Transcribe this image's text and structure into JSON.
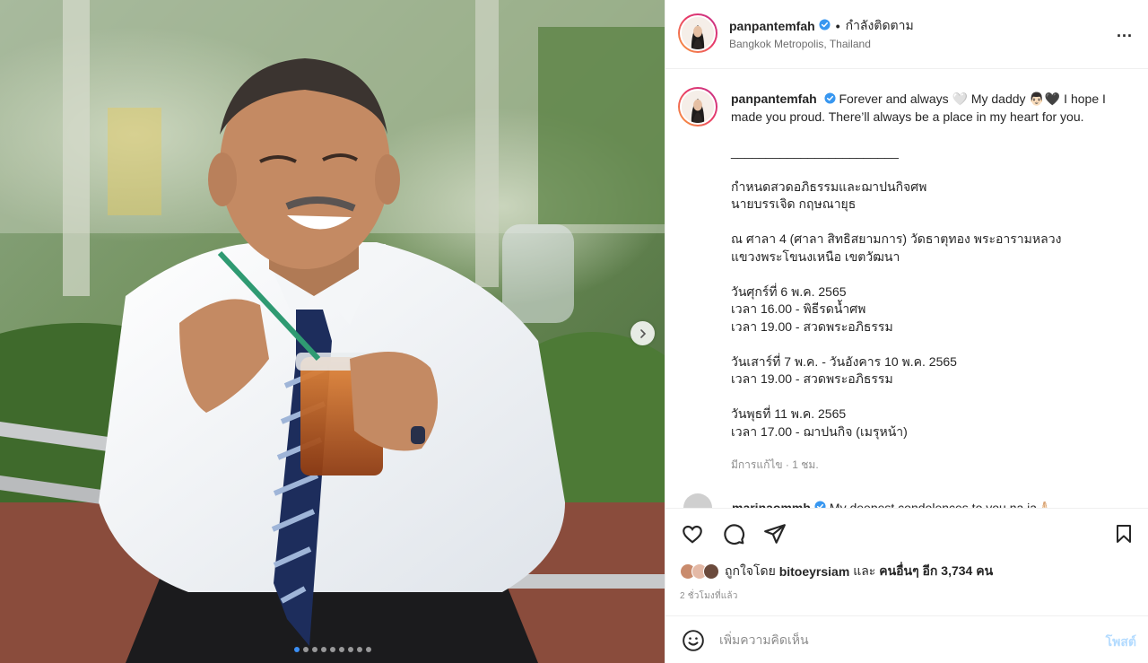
{
  "media": {
    "carousel": {
      "total_slides": 9,
      "active_slide": 1
    }
  },
  "header": {
    "username": "panpantemfah",
    "separator": "•",
    "follow_status": "กำลังติดตาม",
    "location": "Bangkok Metropolis, Thailand",
    "more_label": "..."
  },
  "caption": {
    "username": "panpantemfah",
    "lines": [
      "Forever and always 🤍 My daddy 👨🏻🖤 I hope I",
      "made you proud. There’ll always be a place in my heart for you.",
      "",
      "________________________",
      "",
      "กำหนดสวดอภิธรรมและฌาปนกิจศพ",
      "นายบรรเจิด กฤษณายุธ",
      "",
      "ณ ศาลา 4 (ศาลา สิทธิสยามการ) วัดธาตุทอง พระอารามหลวง",
      "แขวงพระโขนงเหนือ เขตวัฒนา",
      "",
      "วันศุกร์ที่ 6 พ.ค. 2565",
      "เวลา 16.00 - พิธีรดน้ำศพ",
      "เวลา 19.00 - สวดพระอภิธรรม",
      "",
      "วันเสาร์ที่ 7 พ.ค. - วันอังคาร 10 พ.ค. 2565",
      "เวลา 19.00 - สวดพระอภิธรรม",
      "",
      "วันพุธที่ 11 พ.ค. 2565",
      "เวลา 17.00 - ฌาปนกิจ (เมรุหน้า)"
    ],
    "edited": "มีการแก้ไข · 1 ชม."
  },
  "comment_peek": {
    "username": "marinaommh",
    "text": "My deepest condolences to you na ja🙏🏻"
  },
  "actions": {
    "likes_prefix": "ถูกใจโดย",
    "likes_user": "bitoeyrsiam",
    "likes_middle": "และ",
    "likes_others": "คนอื่นๆ อีก 3,734 คน",
    "time_ago": "2 ชั่วโมงที่แล้ว"
  },
  "comment_box": {
    "placeholder": "เพิ่มความคิดเห็น",
    "post_label": "โพสต์"
  },
  "icons": {
    "like": "heart-icon",
    "comment": "comment-icon",
    "share": "paper-plane-icon",
    "save": "bookmark-icon",
    "emoji": "emoji-icon",
    "verified": "verified-badge-icon",
    "next": "chevron-right-icon"
  },
  "colors": {
    "verified": "#3897f0",
    "post_button": "#b3dbff",
    "active_dot": "#3b8ff5",
    "avatar_ring_start": "#f9a13a",
    "avatar_ring_end": "#c22f8b"
  }
}
